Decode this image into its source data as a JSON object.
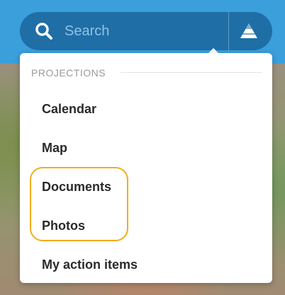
{
  "search": {
    "placeholder": "Search"
  },
  "menu": {
    "section_title": "PROJECTIONS",
    "items": [
      "Calendar",
      "Map",
      "Documents",
      "Photos",
      "My action items"
    ]
  },
  "colors": {
    "accent_blue": "#3a9fdb",
    "search_bar": "#1f6ea6",
    "highlight": "#f3ac1c"
  },
  "icons": {
    "search": "search-icon",
    "logo": "app-logo-icon"
  }
}
